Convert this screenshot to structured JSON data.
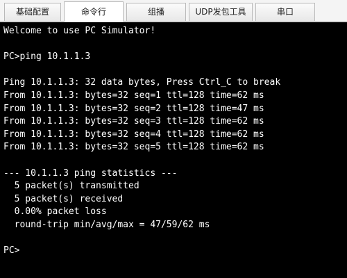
{
  "tabs": [
    {
      "label": "基础配置",
      "active": false
    },
    {
      "label": "命令行",
      "active": true
    },
    {
      "label": "组播",
      "active": false
    },
    {
      "label": "UDP发包工具",
      "active": false
    },
    {
      "label": "串口",
      "active": false
    }
  ],
  "terminal": {
    "lines": [
      "Welcome to use PC Simulator!",
      "",
      "PC>ping 10.1.1.3",
      "",
      "Ping 10.1.1.3: 32 data bytes, Press Ctrl_C to break",
      "From 10.1.1.3: bytes=32 seq=1 ttl=128 time=62 ms",
      "From 10.1.1.3: bytes=32 seq=2 ttl=128 time=47 ms",
      "From 10.1.1.3: bytes=32 seq=3 ttl=128 time=62 ms",
      "From 10.1.1.3: bytes=32 seq=4 ttl=128 time=62 ms",
      "From 10.1.1.3: bytes=32 seq=5 ttl=128 time=62 ms",
      "",
      "--- 10.1.1.3 ping statistics ---",
      "  5 packet(s) transmitted",
      "  5 packet(s) received",
      "  0.00% packet loss",
      "  round-trip min/avg/max = 47/59/62 ms",
      "",
      "PC>"
    ]
  }
}
